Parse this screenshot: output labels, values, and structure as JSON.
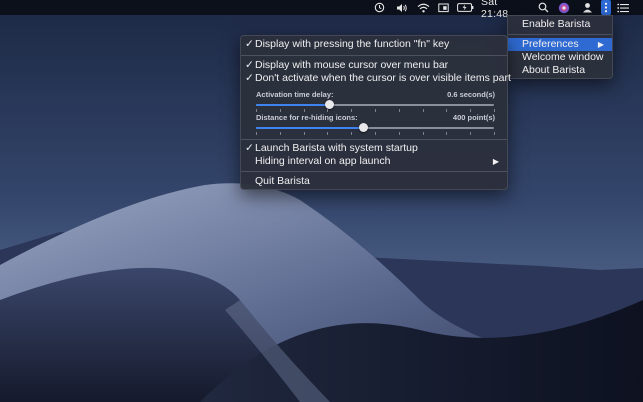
{
  "menubar": {
    "clock": "Sat 21:48",
    "icons": [
      "time-machine-icon",
      "volume-icon",
      "wifi-icon",
      "display-icon",
      "battery-icon",
      "search-icon",
      "siri-icon",
      "user-icon",
      "barista-icon",
      "list-icon"
    ],
    "color": "#e8e8e8"
  },
  "main_menu": {
    "items": [
      {
        "label": "Display with pressing the function \"fn\" key",
        "checked": true
      },
      {
        "label": "Display with mouse cursor over menu bar",
        "checked": true
      },
      {
        "label": "Don't activate when the cursor is over visible items part",
        "checked": true
      },
      {
        "label": "Launch Barista with system startup",
        "checked": true
      },
      {
        "label": "Hiding interval on app launch",
        "checked": false
      },
      {
        "label": "Quit Barista",
        "checked": false
      }
    ],
    "check_glyph": "✓",
    "submenu_arrow": "▶",
    "sliders": [
      {
        "label": "Activation time delay:",
        "value_text": "0.6 second(s)",
        "fraction": 0.31
      },
      {
        "label": "Distance for re-hiding icons:",
        "value_text": "400 point(s)",
        "fraction": 0.45
      }
    ]
  },
  "barista_menu": {
    "items": [
      "Enable Barista",
      "Preferences",
      "Welcome window",
      "About Barista"
    ],
    "highlighted": "Preferences",
    "highlight_color": "#2f6ad2",
    "submenu_arrow": "▶"
  }
}
